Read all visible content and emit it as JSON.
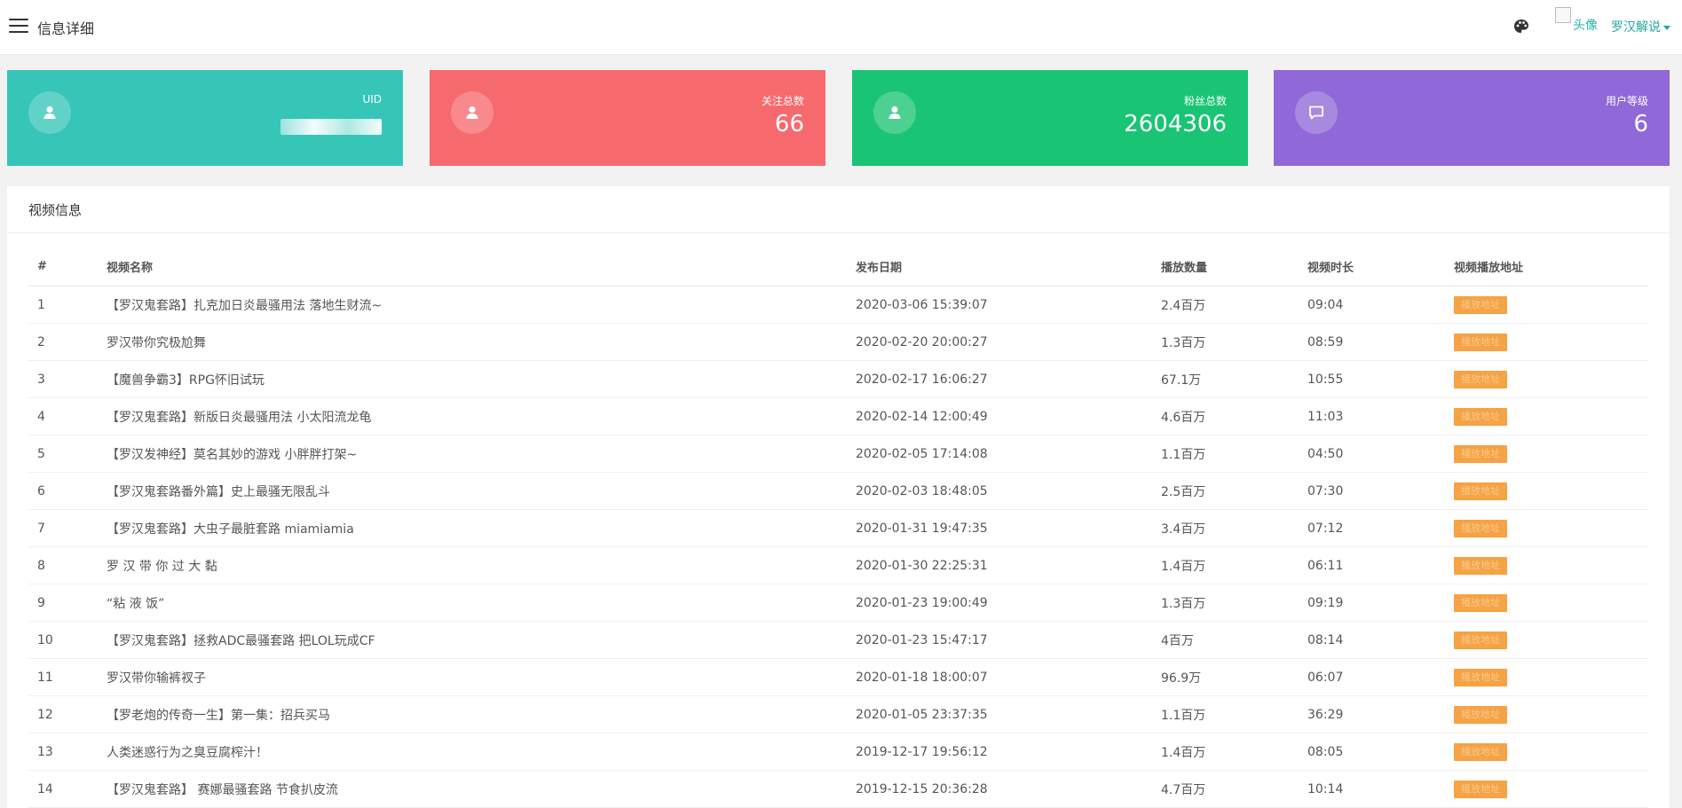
{
  "header": {
    "title": "信息详细",
    "avatar_alt": "头像",
    "user_name": "罗汉解说"
  },
  "cards": [
    {
      "label": "UID",
      "value": "",
      "color": "#36c6b8",
      "icon": "user-icon"
    },
    {
      "label": "关注总数",
      "value": "66",
      "color": "#f66a6d",
      "icon": "user-icon"
    },
    {
      "label": "粉丝总数",
      "value": "2604306",
      "color": "#1ac475",
      "icon": "user-icon"
    },
    {
      "label": "用户等级",
      "value": "6",
      "color": "#9068d8",
      "icon": "chat-icon"
    }
  ],
  "panel": {
    "title": "视频信息",
    "columns": [
      "#",
      "视频名称",
      "发布日期",
      "播放数量",
      "视频时长",
      "视频播放地址"
    ],
    "play_label": "播放地址",
    "rows": [
      {
        "no": "1",
        "name": "【罗汉鬼套路】扎克加日炎最骚用法 落地生财流~",
        "date": "2020-03-06 15:39:07",
        "plays": "2.4百万",
        "duration": "09:04"
      },
      {
        "no": "2",
        "name": "罗汉带你究极尬舞",
        "date": "2020-02-20 20:00:27",
        "plays": "1.3百万",
        "duration": "08:59"
      },
      {
        "no": "3",
        "name": "【魔兽争霸3】RPG怀旧试玩",
        "date": "2020-02-17 16:06:27",
        "plays": "67.1万",
        "duration": "10:55"
      },
      {
        "no": "4",
        "name": "【罗汉鬼套路】新版日炎最骚用法 小太阳流龙龟",
        "date": "2020-02-14 12:00:49",
        "plays": "4.6百万",
        "duration": "11:03"
      },
      {
        "no": "5",
        "name": "【罗汉发神经】莫名其妙的游戏 小胖胖打架~",
        "date": "2020-02-05 17:14:08",
        "plays": "1.1百万",
        "duration": "04:50"
      },
      {
        "no": "6",
        "name": "【罗汉鬼套路番外篇】史上最骚无限乱斗",
        "date": "2020-02-03 18:48:05",
        "plays": "2.5百万",
        "duration": "07:30"
      },
      {
        "no": "7",
        "name": "【罗汉鬼套路】大虫子最脏套路 miamiamia",
        "date": "2020-01-31 19:47:35",
        "plays": "3.4百万",
        "duration": "07:12"
      },
      {
        "no": "8",
        "name": "罗 汉 带 你 过 大 黏",
        "date": "2020-01-30 22:25:31",
        "plays": "1.4百万",
        "duration": "06:11"
      },
      {
        "no": "9",
        "name": "“粘 液 饭”",
        "date": "2020-01-23 19:00:49",
        "plays": "1.3百万",
        "duration": "09:19"
      },
      {
        "no": "10",
        "name": "【罗汉鬼套路】拯救ADC最骚套路 把LOL玩成CF",
        "date": "2020-01-23 15:47:17",
        "plays": "4百万",
        "duration": "08:14"
      },
      {
        "no": "11",
        "name": "罗汉带你输裤衩子",
        "date": "2020-01-18 18:00:07",
        "plays": "96.9万",
        "duration": "06:07"
      },
      {
        "no": "12",
        "name": "【罗老炮的传奇一生】第一集：招兵买马",
        "date": "2020-01-05 23:37:35",
        "plays": "1.1百万",
        "duration": "36:29"
      },
      {
        "no": "13",
        "name": "人类迷惑行为之臭豆腐榨汁！",
        "date": "2019-12-17 19:56:12",
        "plays": "1.4百万",
        "duration": "08:05"
      },
      {
        "no": "14",
        "name": "【罗汉鬼套路】 赛娜最骚套路 节食扒皮流",
        "date": "2019-12-15 20:36:28",
        "plays": "4.7百万",
        "duration": "10:14"
      }
    ]
  },
  "colors": {
    "accent": "#20a8a0",
    "play_button": "#f5a344"
  }
}
